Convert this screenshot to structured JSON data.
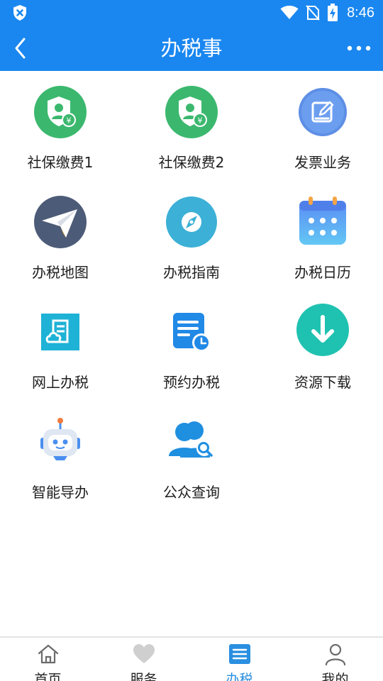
{
  "status_bar": {
    "time": "8:46",
    "icons": [
      "shield-x-icon",
      "wifi-icon",
      "no-sim-icon",
      "battery-charging-icon"
    ]
  },
  "header": {
    "title": "办税事",
    "back_icon": "chevron-left-icon",
    "more_icon": "more-horizontal-icon"
  },
  "services": [
    {
      "label": "社保缴费1",
      "icon": "social-security-payment-icon"
    },
    {
      "label": "社保缴费2",
      "icon": "social-security-payment-icon"
    },
    {
      "label": "发票业务",
      "icon": "invoice-edit-icon"
    },
    {
      "label": "办税地图",
      "icon": "paper-plane-icon"
    },
    {
      "label": "办税指南",
      "icon": "compass-icon"
    },
    {
      "label": "办税日历",
      "icon": "calendar-icon"
    },
    {
      "label": "网上办税",
      "icon": "cloud-document-icon"
    },
    {
      "label": "预约办税",
      "icon": "document-clock-icon"
    },
    {
      "label": "资源下载",
      "icon": "download-icon"
    },
    {
      "label": "智能导办",
      "icon": "robot-icon"
    },
    {
      "label": "公众查询",
      "icon": "people-search-icon"
    }
  ],
  "tabs": [
    {
      "label": "首页",
      "icon": "home-icon",
      "active": false
    },
    {
      "label": "服务",
      "icon": "heart-icon",
      "active": false
    },
    {
      "label": "办税",
      "icon": "list-icon",
      "active": true
    },
    {
      "label": "我的",
      "icon": "user-icon",
      "active": false
    }
  ],
  "colors": {
    "primary": "#1a87f0",
    "green": "#3bb86e",
    "teal": "#1fc2b0",
    "active_tab": "#2a8fe0"
  }
}
